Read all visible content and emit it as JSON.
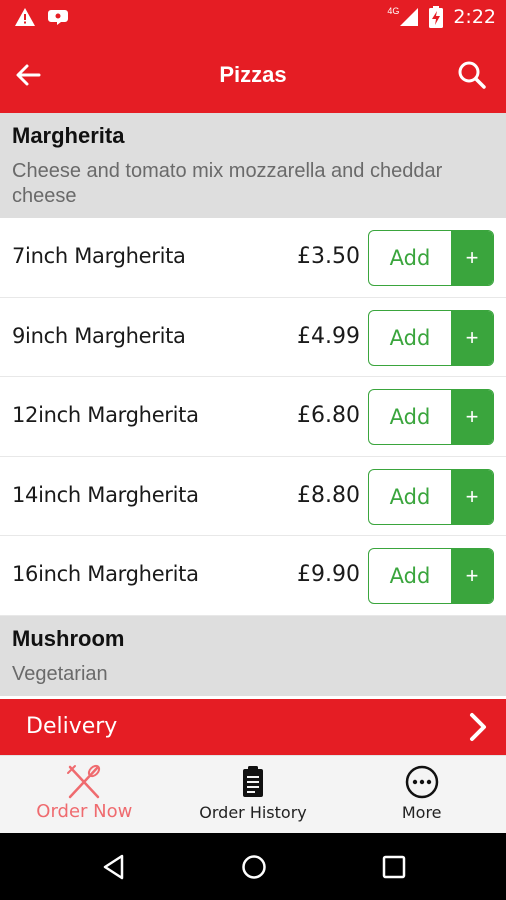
{
  "status_bar": {
    "time": "2:22",
    "network": "4G",
    "icons": [
      "warning-icon",
      "cast-icon",
      "signal-icon",
      "battery-charging-icon"
    ]
  },
  "app_bar": {
    "title": "Pizzas",
    "back_icon": "arrow-left-icon",
    "search_icon": "search-icon"
  },
  "sections": [
    {
      "name": "Margherita",
      "description": "Cheese and tomato mix mozzarella and cheddar cheese",
      "items": [
        {
          "label": "7inch Margherita",
          "price": "£3.50",
          "add_label": "Add",
          "plus": "+"
        },
        {
          "label": "9inch Margherita",
          "price": "£4.99",
          "add_label": "Add",
          "plus": "+"
        },
        {
          "label": "12inch Margherita",
          "price": "£6.80",
          "add_label": "Add",
          "plus": "+"
        },
        {
          "label": "14inch Margherita",
          "price": "£8.80",
          "add_label": "Add",
          "plus": "+"
        },
        {
          "label": "16inch Margherita",
          "price": "£9.90",
          "add_label": "Add",
          "plus": "+"
        }
      ]
    },
    {
      "name": "Mushroom",
      "description": "Vegetarian",
      "items": []
    }
  ],
  "delivery": {
    "label": "Delivery",
    "icon": "chevron-right-icon"
  },
  "bottom_nav": [
    {
      "label": "Order Now",
      "icon": "fork-knife-icon",
      "active": true
    },
    {
      "label": "Order History",
      "icon": "clipboard-icon",
      "active": false
    },
    {
      "label": "More",
      "icon": "more-dots-icon",
      "active": false
    }
  ],
  "colors": {
    "primary": "#e51d24",
    "accent_green": "#3aa53d",
    "active_tab": "#ef6b6f",
    "section_bg": "#dedede"
  }
}
